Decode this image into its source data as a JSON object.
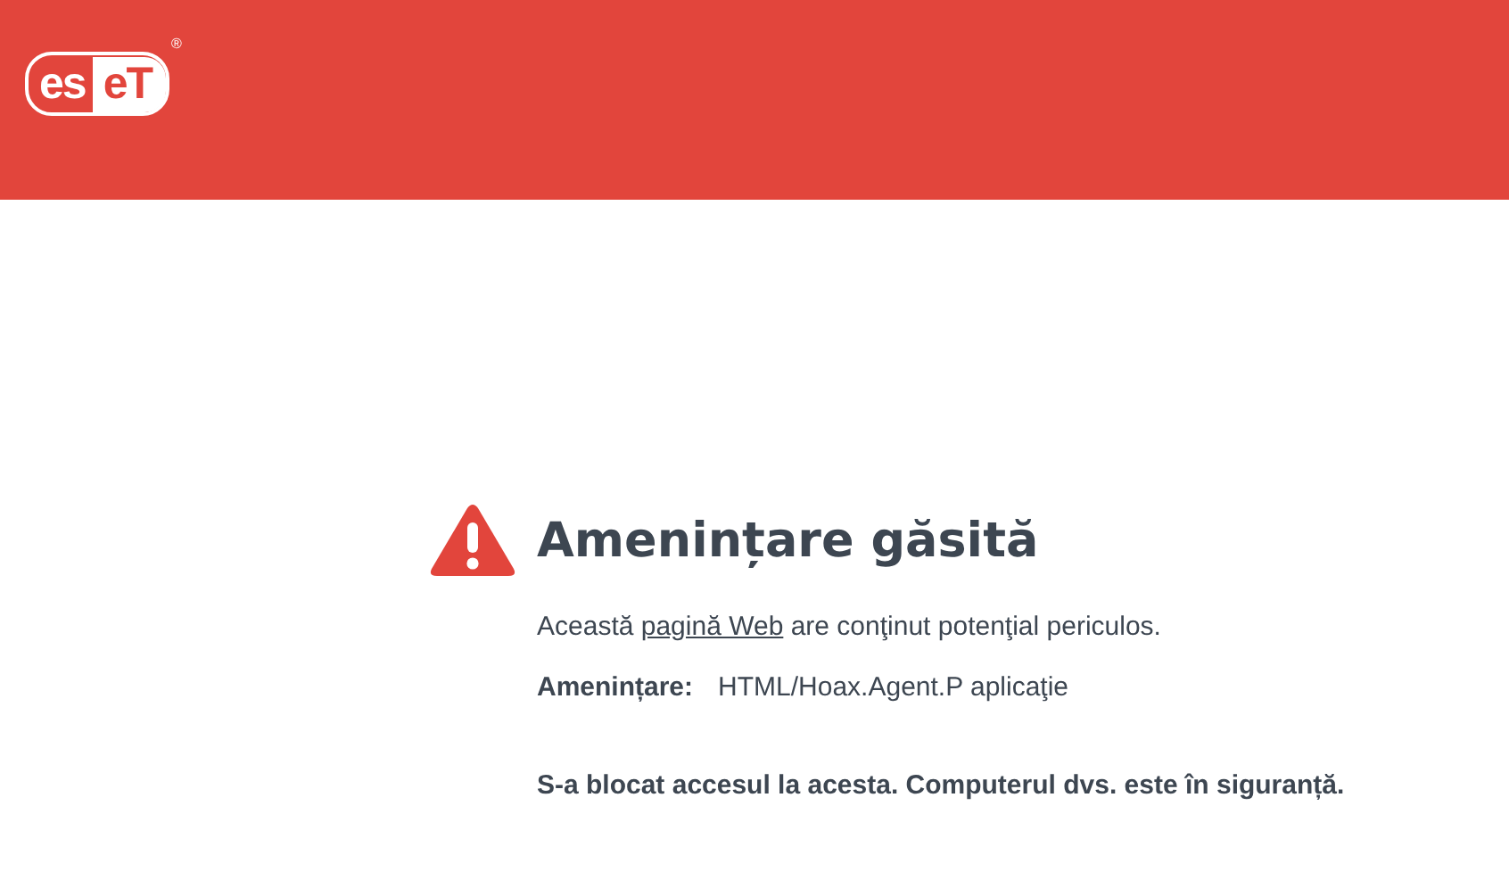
{
  "logo": {
    "left": "es",
    "right": "eT",
    "mark": "®"
  },
  "title": "Amenințare găsită",
  "description": {
    "before": "Această ",
    "link": "pagină Web",
    "after": " are conţinut potenţial periculos."
  },
  "threat": {
    "label": "Amenințare:",
    "value": "HTML/Hoax.Agent.P aplicaţie"
  },
  "message": "S-a blocat accesul la acesta. Computerul dvs. este în siguranță."
}
